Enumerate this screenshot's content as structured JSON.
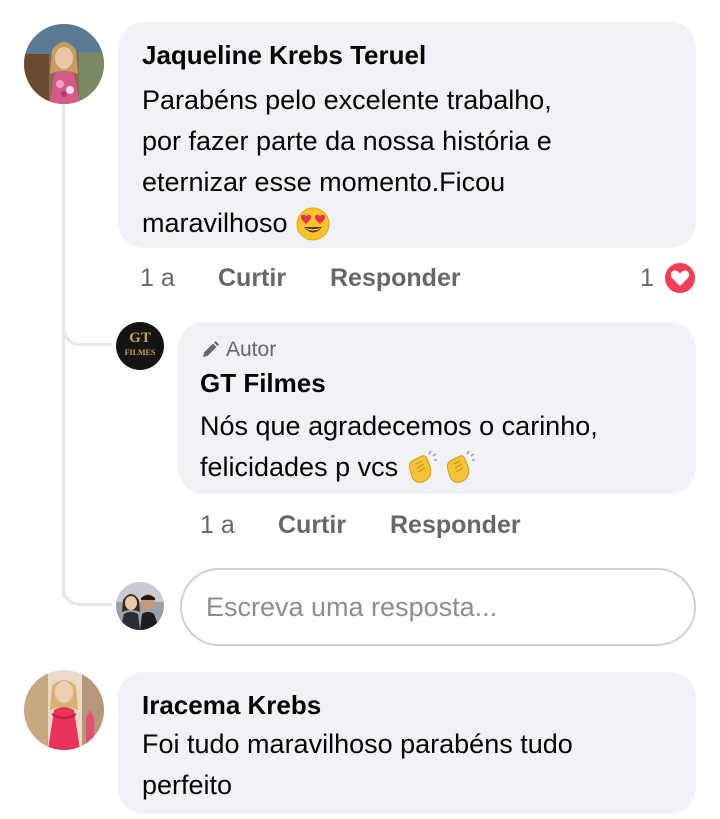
{
  "comments": [
    {
      "author": "Jaqueline Krebs Teruel",
      "lines": [
        "Parabéns pelo excelente trabalho,",
        "por fazer parte da nossa história e",
        "eternizar esse momento.Ficou",
        "maravilhoso"
      ],
      "emoji": "heart-eyes-emoji",
      "time": "1 a",
      "like_label": "Curtir",
      "reply_label": "Responder",
      "reaction_count": "1",
      "reaction_icon": "love-reaction-icon"
    },
    {
      "author": "Iracema Krebs",
      "lines": [
        "Foi tudo maravilhoso parabéns tudo",
        "perfeito"
      ]
    }
  ],
  "reply": {
    "badge_label": "Autor",
    "badge_icon": "pencil-icon",
    "author": "GT Filmes",
    "logo_text_top": "GT",
    "logo_text_bottom": "FILMES",
    "lines": [
      "Nós que agradecemos o carinho,",
      "felicidades p vcs"
    ],
    "emoji": "clapping-hands-emoji",
    "time": "1 a",
    "like_label": "Curtir",
    "reply_label": "Responder"
  },
  "reply_input": {
    "placeholder": "Escreva uma resposta..."
  },
  "colors": {
    "bubble": "#f0f2f5",
    "meta_text": "#65676b",
    "love_red": "#f33e58",
    "logo_gold": "#c9a04a"
  }
}
